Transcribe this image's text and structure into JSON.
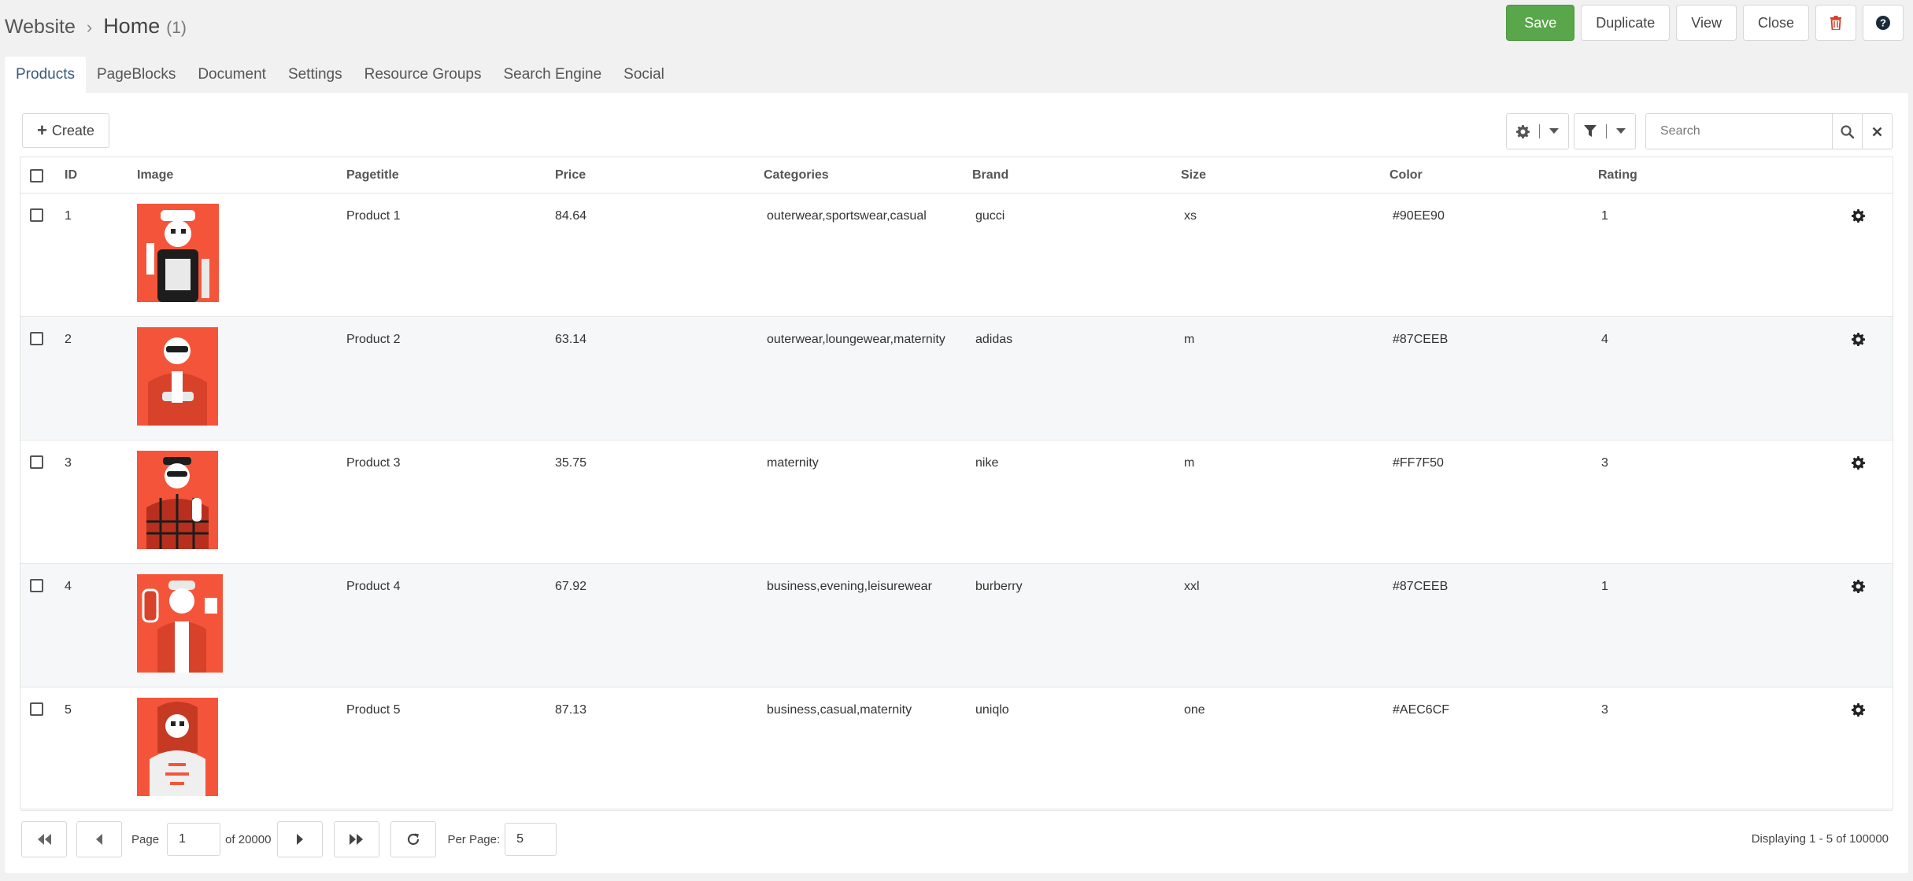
{
  "breadcrumb": {
    "parent": "Website",
    "separator": "›",
    "current": "Home",
    "count": "(1)"
  },
  "toolbar": {
    "save": "Save",
    "duplicate": "Duplicate",
    "view": "View",
    "close": "Close"
  },
  "tabs": [
    "Products",
    "PageBlocks",
    "Document",
    "Settings",
    "Resource Groups",
    "Search Engine",
    "Social"
  ],
  "grid": {
    "create_label": "Create",
    "search_placeholder": "Search",
    "columns": [
      "ID",
      "Image",
      "Pagetitle",
      "Price",
      "Categories",
      "Brand",
      "Size",
      "Color",
      "Rating"
    ],
    "rows": [
      {
        "id": "1",
        "pagetitle": "Product 1",
        "price": "84.64",
        "categories": "outerwear,sportswear,casual",
        "brand": "gucci",
        "size": "xs",
        "color": "#90EE90",
        "rating": "1"
      },
      {
        "id": "2",
        "pagetitle": "Product 2",
        "price": "63.14",
        "categories": "outerwear,loungewear,maternity",
        "brand": "adidas",
        "size": "m",
        "color": "#87CEEB",
        "rating": "4"
      },
      {
        "id": "3",
        "pagetitle": "Product 3",
        "price": "35.75",
        "categories": "maternity",
        "brand": "nike",
        "size": "m",
        "color": "#FF7F50",
        "rating": "3"
      },
      {
        "id": "4",
        "pagetitle": "Product 4",
        "price": "67.92",
        "categories": "business,evening,leisurewear",
        "brand": "burberry",
        "size": "xxl",
        "color": "#87CEEB",
        "rating": "1"
      },
      {
        "id": "5",
        "pagetitle": "Product 5",
        "price": "87.13",
        "categories": "business,casual,maternity",
        "brand": "uniqlo",
        "size": "one",
        "color": "#AEC6CF",
        "rating": "3"
      }
    ]
  },
  "pager": {
    "page_label": "Page",
    "page_value": "1",
    "of_label": "of 20000",
    "per_page_label": "Per Page:",
    "per_page_value": "5",
    "display_text": "Displaying 1 - 5 of 100000"
  },
  "colors": {
    "save_green": "#5aa64a",
    "thumb_bg": "#f4553a",
    "active_tab": "#3a5a7a",
    "danger": "#d0402b"
  },
  "icons": [
    "chevron-right-icon",
    "trash-icon",
    "help-icon",
    "plus-icon",
    "gear-icon",
    "caret-down-icon",
    "filter-icon",
    "search-icon",
    "close-icon",
    "first-page-icon",
    "prev-page-icon",
    "next-page-icon",
    "last-page-icon",
    "refresh-icon"
  ]
}
